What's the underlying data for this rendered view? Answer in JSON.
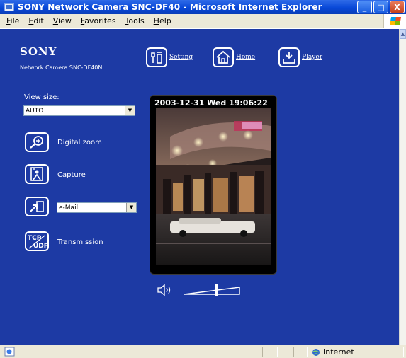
{
  "window": {
    "title": "SONY Network Camera SNC-DF40 - Microsoft Internet Explorer",
    "minimize_glyph": "_",
    "maximize_glyph": "□",
    "close_glyph": "X"
  },
  "menu": [
    "File",
    "Edit",
    "View",
    "Favorites",
    "Tools",
    "Help"
  ],
  "brand": {
    "logo": "SONY",
    "model": "Network Camera SNC-DF40N"
  },
  "nav": {
    "setting": "Setting",
    "home": "Home",
    "player": "Player"
  },
  "controls": {
    "view_size_label": "View size:",
    "view_size_value": "AUTO",
    "digital_zoom": "Digital zoom",
    "capture": "Capture",
    "send_target_value": "e-Mail",
    "transmission": "Transmission",
    "transmission_icon_text_top": "TCP",
    "transmission_icon_text_bottom": "UDP"
  },
  "camera": {
    "timestamp": "2003-12-31 Wed 19:06:22",
    "volume_level": 0.6
  },
  "status": {
    "zone": "Internet"
  },
  "colors": {
    "page_background": "#1d3aa4",
    "titlebar": "#0848d8"
  }
}
